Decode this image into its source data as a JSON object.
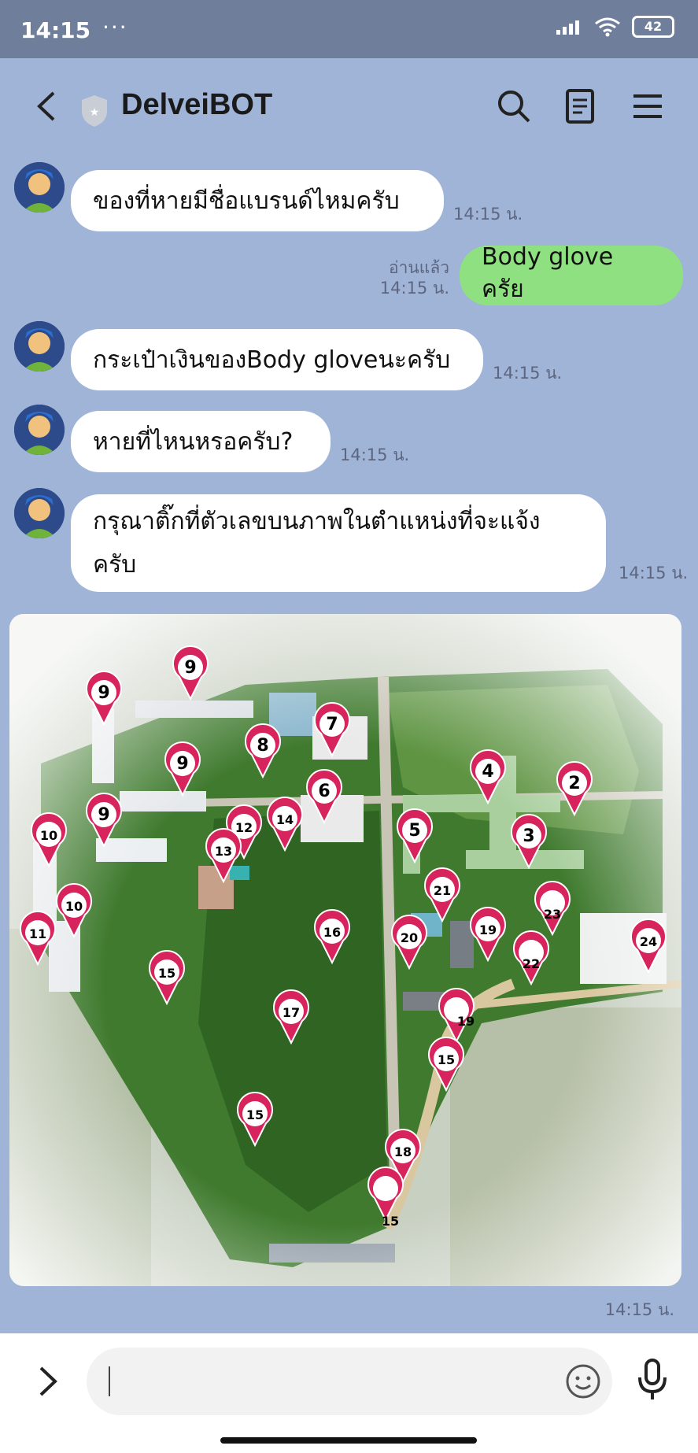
{
  "status": {
    "time": "14:15",
    "dots": "···",
    "battery": "42"
  },
  "header": {
    "title": "DelveiBOT"
  },
  "messages": [
    {
      "text": "ของที่หายมีชื่อแบรนด์ไหมครับ",
      "time": "14:15 น."
    },
    {
      "text": "Body glove ครัย",
      "read": "อ่านแล้ว",
      "time": "14:15 น."
    },
    {
      "text": "กระเป๋าเงินของBody gloveนะครับ",
      "time": "14:15 น."
    },
    {
      "text": "หายที่ไหนหรอครับ?",
      "time": "14:15 น."
    },
    {
      "line1": "กรุณาติ๊กที่ตัวเลขบนภาพในตำแหน่งที่จะแจ้ง",
      "line2": "ครับ",
      "time": "14:15 น."
    },
    {
      "time": "14:15 น."
    }
  ],
  "map_pins": [
    "9",
    "9",
    "9",
    "9",
    "8",
    "7",
    "6",
    "14",
    "12",
    "13",
    "10",
    "10",
    "11",
    "4",
    "2",
    "5",
    "3",
    "21",
    "23",
    "16",
    "20",
    "19",
    "22",
    "24",
    "15",
    "17",
    "19",
    "15",
    "15",
    "18",
    "15"
  ],
  "icons": {
    "back": "chevron-left-icon",
    "shield": "shield-icon",
    "search": "search-icon",
    "notes": "notes-icon",
    "menu": "hamburger-menu-icon",
    "expand": "chevron-right-icon",
    "emoji": "emoji-icon",
    "mic": "microphone-icon"
  },
  "colors": {
    "background": "#a0b4d8",
    "mine_bubble": "#8fe081",
    "pin": "#d8245c"
  }
}
